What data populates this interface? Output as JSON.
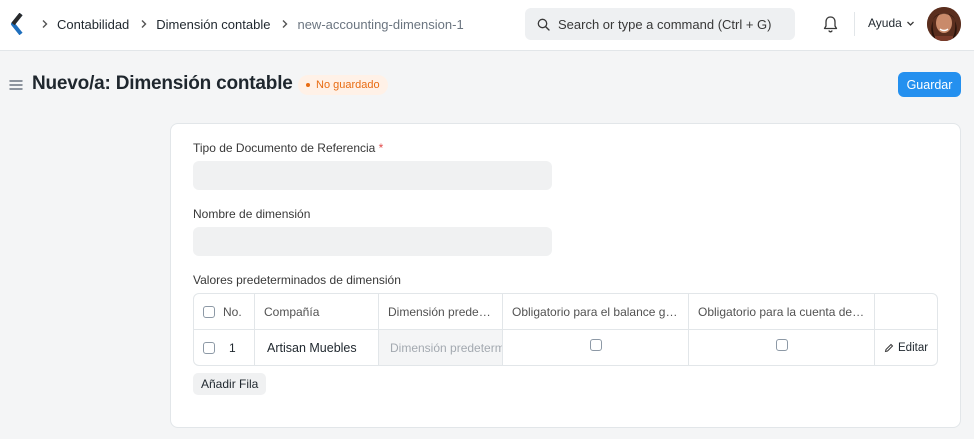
{
  "navbar": {
    "breadcrumbs": [
      "Contabilidad",
      "Dimensión contable",
      "new-accounting-dimension-1"
    ],
    "search_placeholder": "Search or type a command (Ctrl + G)",
    "help_label": "Ayuda"
  },
  "page": {
    "title": "Nuevo/a: Dimensión contable",
    "status_badge": "No guardado",
    "save_label": "Guardar"
  },
  "form": {
    "reference_doctype_label": "Tipo de Documento de Referencia",
    "reference_doctype_required": "*",
    "reference_doctype_value": "",
    "dimension_name_label": "Nombre de dimensión",
    "dimension_name_value": "",
    "defaults_label": "Valores predeterminados de dimensión"
  },
  "table": {
    "columns": [
      "No.",
      "Compañía",
      "Dimensión predeterminada",
      "Obligatorio para el balance general",
      "Obligatorio para la cuenta de pérdidas y ganancias"
    ],
    "rows": [
      {
        "no": "1",
        "company": "Artisan Muebles",
        "default_dimension_placeholder": "Dimensión predeterminada",
        "mandatory_bs": false,
        "mandatory_pl": false,
        "edit_label": "Editar"
      }
    ],
    "add_row_label": "Añadir Fila"
  },
  "colors": {
    "primary": "#2490ef",
    "badge_text": "#e86c13",
    "badge_bg": "#fff1e7",
    "required": "#e24c4c"
  },
  "icons": [
    "app-logo-icon",
    "chevron-right-icon",
    "search-icon",
    "bell-icon",
    "chevron-down-icon",
    "menu-icon",
    "pencil-icon"
  ]
}
